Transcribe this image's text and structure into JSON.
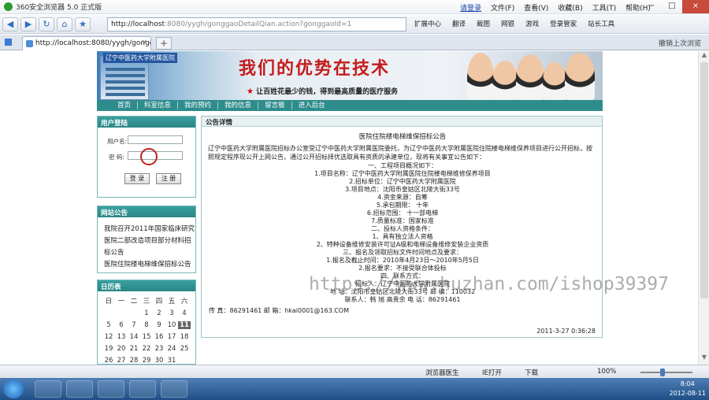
{
  "browser": {
    "title": "360安全浏览器 5.0 正式版",
    "menu": [
      "请登录",
      "文件(F)",
      "查看(V)",
      "收藏(B)",
      "工具(T)",
      "帮助(H)"
    ],
    "window_buttons": [
      "−",
      "□",
      "×"
    ],
    "address_url_host": "http://localhost",
    "address_url_rest": ":8080/yygh/gonggaoDetailQian.action?gonggaoId=1",
    "nav_tools": [
      "扩展中心",
      "翻译",
      "截图",
      "网银",
      "游戏",
      "登录管家",
      "站长工具"
    ],
    "tab_title": "http://localhost:8080/yygh/gonggao...",
    "restore_label": "撤销上次浏览"
  },
  "site": {
    "hospital_name": "辽宁中医药大学附属医院",
    "slogan": "我们的优势在技术",
    "subslogan": "让百姓花最少的钱，得到最高质量的医疗服务",
    "nav": [
      "首页",
      "科室信息",
      "我的预约",
      "我的信息",
      "留言板",
      "进入后台"
    ]
  },
  "login_box": {
    "title": "用户登陆",
    "username_label": "用户名:",
    "password_label": "密  码:",
    "login_button": "登 录",
    "register_button": "注 册"
  },
  "news_box": {
    "title": "网站公告",
    "items": [
      "我院召开2011年国家临床研究",
      "医院二部改造项目部分材料招",
      "标公告",
      "医院住院楼电梯维保招标公告"
    ]
  },
  "calendar": {
    "title": "日历表",
    "weekdays": [
      "日",
      "一",
      "二",
      "三",
      "四",
      "五",
      "六"
    ],
    "today": "11"
  },
  "announcement": {
    "header": "公告详情",
    "title": "医院住院楼电梯维保招标公告",
    "intro": "辽宁中医药大学附属医院招标办公室受辽宁中医药大学附属医院委托，为辽宁中医药大学附属医院住院楼电梯维保养项目进行公开招标，按照规定程序现公开上网公告，通过公开招标择优选取具有资质的承建单位，现将有关事宜公告如下：",
    "lines": [
      "一、工程项目概况如下：",
      "1.项目名称：辽宁中医药大学附属医院住院楼电梯维修保养项目",
      "2.招标单位：辽宁中医药大学附属医院",
      "3.项目地点：沈阳市皇姑区北陵大街33号",
      "4.资金来源：自筹",
      "5.承包期限：  十年",
      "6.招标范围：  十一部电梯",
      "7.质量标准：国家标准",
      "二、投标人资格条件：",
      "1、具有独立法人资格",
      "2、特种设备维修安装许可证A级和电梯设备维修安装企业资质",
      "三、报名及领取招标文件时间地点及要求：",
      "1.报名及截止时间：2010年4月23日～2010年5月5日",
      "2.报名要求：不接受联合体投标",
      "四、联系方式：",
      "招标人：辽宁中医药大学附属医院",
      "地  址：沈阳市皇姑区北陵大街33号      邮  编：110032",
      "联系人：韩 旭      高贵余        电  话：86291461"
    ],
    "contact": "传 真：86291461                    邮 箱：hkai0001@163.COM",
    "date": "2011-3-27 0:36:28"
  },
  "watermark": "https://www.huzhan.com/ishop39397",
  "statusbar": {
    "items": [
      "浏览器医生",
      "IE打开",
      "下载",
      "100%"
    ]
  },
  "taskbar": {
    "time": "8:04",
    "date": "2012-08-11"
  }
}
